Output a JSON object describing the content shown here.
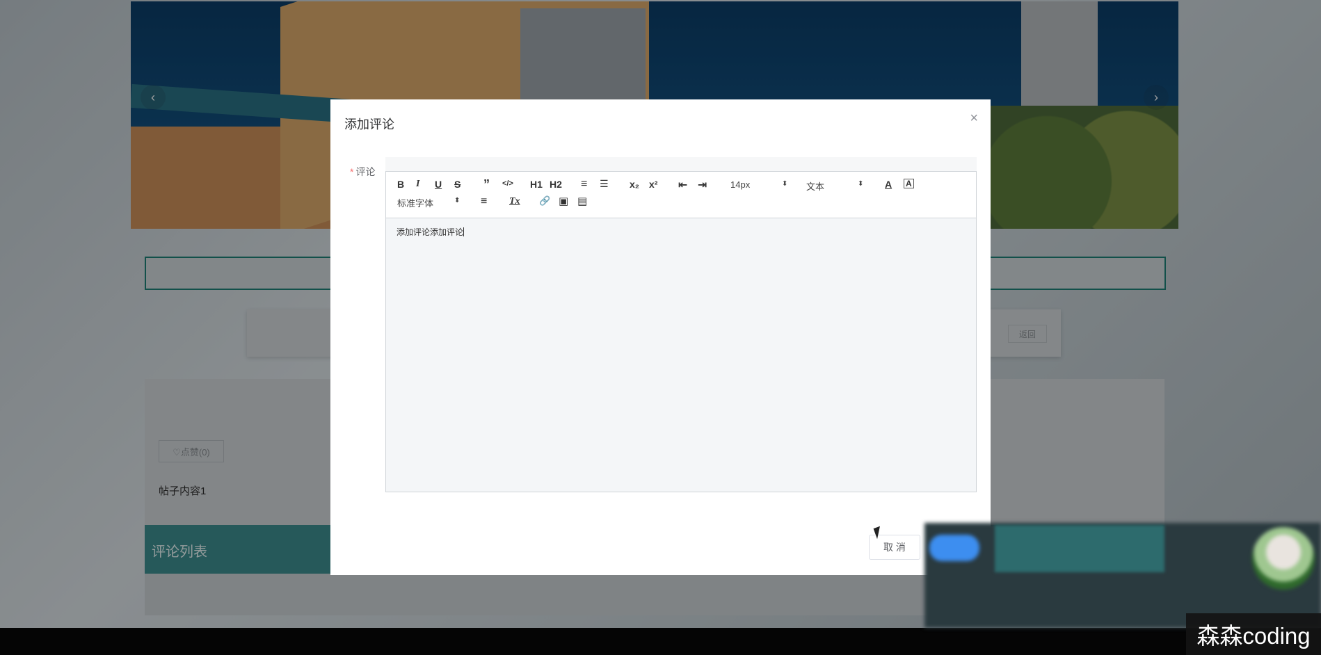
{
  "background_page": {
    "banner_prev": "‹",
    "banner_next": "›",
    "back_button": "返回",
    "like_button": "♡点赞(0)",
    "post_content": "帖子内容1",
    "comments_title": "评论列表"
  },
  "dialog": {
    "title": "添加评论",
    "close_label": "×",
    "field_label": "评论",
    "required_mark": "*",
    "editor": {
      "bold": "B",
      "italic": "I",
      "underline": "U",
      "strike": "S",
      "quote": "”",
      "code": "</>",
      "h1": "H1",
      "h2": "H2",
      "ordered_list": "≡",
      "bullet_list": "☰",
      "subscript": "x₂",
      "superscript": "x²",
      "outdent": "⇤",
      "indent": "⇥",
      "font_size": "14px",
      "header_type": "文本",
      "color": "A",
      "background": "A",
      "font_family": "标准字体",
      "align": "≡",
      "clean": "Tx",
      "link": "🔗",
      "image": "▣",
      "video": "▤",
      "content": "添加评论添加评论"
    },
    "cancel_button": "取 消"
  },
  "watermark": "森森coding"
}
